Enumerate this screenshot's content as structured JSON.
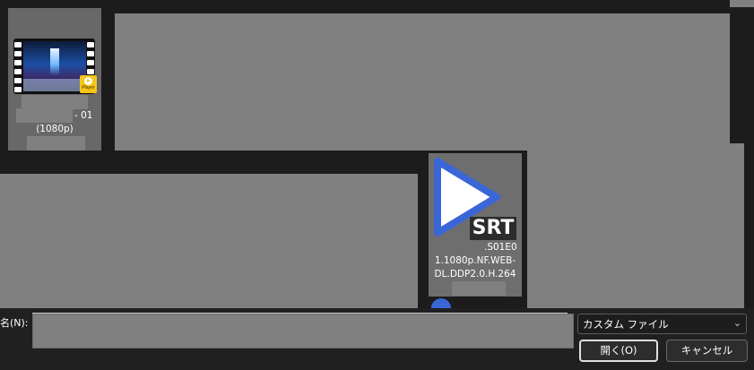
{
  "files": [
    {
      "kind": "video",
      "name_line1": "- 01",
      "name_line2": "(1080p)",
      "badge_text": "Player",
      "icon": "video-file-icon"
    },
    {
      "kind": "subtitle",
      "badge": "SRT",
      "name_line1": ".S01E0",
      "name_line2": "1.1080p.NF.WEB-",
      "name_line3": "DL.DDP2.0.H.264",
      "icon": "srt-file-icon"
    }
  ],
  "footer": {
    "filename_label": "名(N):",
    "filename_value": "",
    "filter_value": "カスタム ファイル",
    "open_label": "開く(O)",
    "cancel_label": "キャンセル"
  },
  "colors": {
    "background": "#1c1c1c",
    "redacted_block": "#808080",
    "srt_play_blue": "#3a66d8",
    "player_badge_yellow": "#f5c518"
  }
}
